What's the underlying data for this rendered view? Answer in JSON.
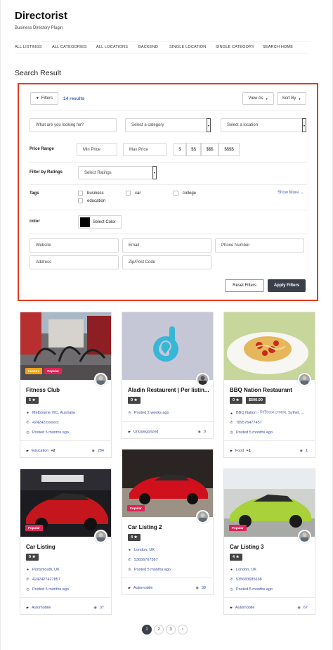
{
  "site": {
    "title": "Directorist",
    "tagline": "Business Directory Plugin"
  },
  "nav": [
    "ALL LISTINGS",
    "ALL CATEGORIES",
    "ALL LOCATIONS",
    "BACKEND",
    "SINGLE LOCATION",
    "SINGLE CATEGORY",
    "SEARCH HOME"
  ],
  "search_heading": "Search Result",
  "filters": {
    "filters_button": "Filters",
    "results_count": "14 results",
    "view_as": "View As",
    "sort_by": "Sort By",
    "keyword_placeholder": "What are you looking for?",
    "category_select": "Select a category",
    "location_select": "Select a location",
    "price_range_label": "Price Range",
    "min_price_placeholder": "Min Price",
    "max_price_placeholder": "Max Price",
    "price_levels": [
      "$",
      "$$",
      "$$$",
      "$$$$"
    ],
    "ratings_label": "Filter by Ratings",
    "ratings_select": "Select Ratings",
    "tags_label": "Tags",
    "tags": [
      "business",
      "car",
      "college",
      "education"
    ],
    "show_more": "Show More",
    "color_label": "color",
    "select_color": "Select Color",
    "swatch_color": "#000000",
    "website_placeholder": "Website",
    "email_placeholder": "Email",
    "phone_placeholder": "Phone Number",
    "address_placeholder": "Address",
    "zip_placeholder": "Zip/Post Code",
    "reset_button": "Reset Filters",
    "apply_button": "Apply Filters"
  },
  "listings": [
    {
      "title": "Fitness Club",
      "rating": "5 ★",
      "badges": [
        "Feature",
        "Popular"
      ],
      "location": "Melbourne VIC, Australia",
      "phone": "424242xxxxxxx",
      "posted": "Posted 5 months ago",
      "category": "Education",
      "category_extra": "+2",
      "views": "284"
    },
    {
      "title": "Aladin Restaurent | Per listin...",
      "rating": "0 ★",
      "badges": [],
      "posted": "Posted 2 weeks ago",
      "category": "Uncategorized",
      "views": "0"
    },
    {
      "title": "BBQ Nation Restaurant",
      "rating": "0 ★",
      "price": "$500.00",
      "badges": [],
      "location": "BBQ Nation - সিটিজেন দোকান, Sylhet, ...",
      "phone": "789576477457",
      "posted": "Posted 5 months ago",
      "category": "Food",
      "category_extra": "+1",
      "views": "1"
    },
    {
      "title": "Car Listing",
      "rating": "0 ★",
      "badges": [
        "Popular"
      ],
      "location": "Portsmouth, UK",
      "phone": "4242427427857",
      "posted": "Posted 5 months ago",
      "category": "Automobile",
      "views": "37"
    },
    {
      "title": "Car Listing 2",
      "rating": "4 ★",
      "badges": [
        "Popular"
      ],
      "location": "London, UK",
      "phone": "53656767567",
      "posted": "Posted 5 months ago",
      "category": "Automobile",
      "views": "38"
    },
    {
      "title": "Car Listing 3",
      "rating": "4 ★",
      "badges": [
        "Popular"
      ],
      "location": "London, UK",
      "phone": "535683685638",
      "posted": "Posted 5 months ago",
      "category": "Automobile",
      "views": "67"
    }
  ],
  "pagination": [
    "1",
    "2",
    "3",
    "›"
  ],
  "colors": {
    "accent": "#e53b1e",
    "link": "#3a4ea1",
    "dark_button": "#3b3f4a",
    "feature_badge": "#f6a213",
    "popular_badge": "#e02457"
  }
}
